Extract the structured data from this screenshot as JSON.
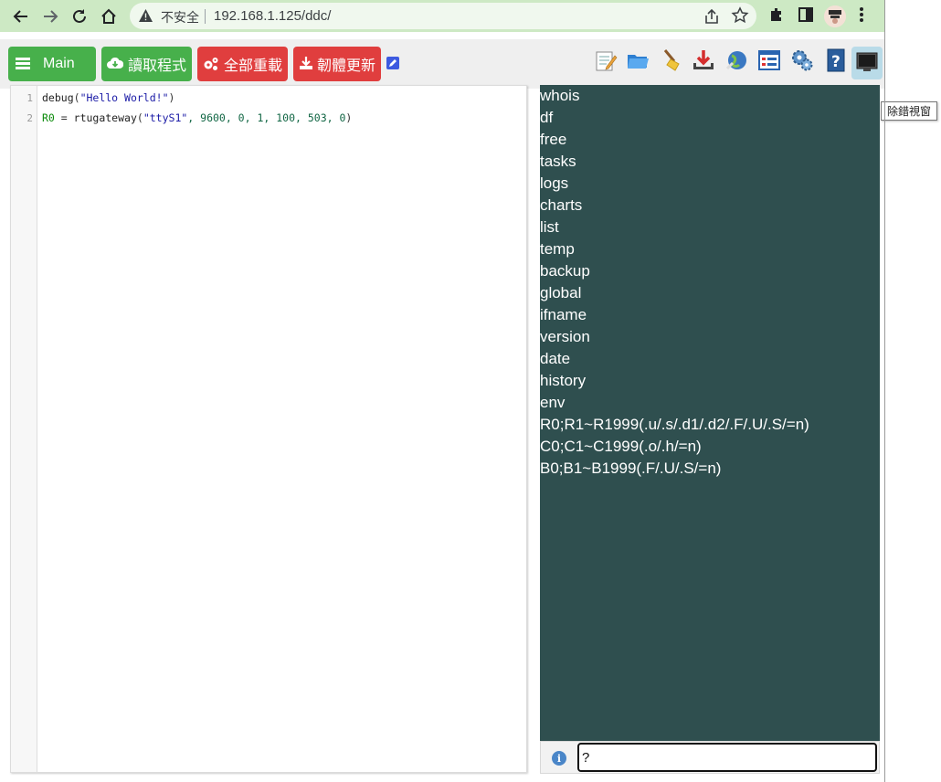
{
  "browser": {
    "insecure_label": "不安全",
    "url": "192.168.1.125/ddc/"
  },
  "toolbar": {
    "main_label": "Main",
    "read_label": "讀取程式",
    "reset_label": "全部重載",
    "firmware_label": "韌體更新",
    "tooltip": "除錯視窗"
  },
  "tools": [
    {
      "name": "edit-notes-icon"
    },
    {
      "name": "folder-open-icon"
    },
    {
      "name": "broom-icon"
    },
    {
      "name": "download-icon"
    },
    {
      "name": "network-globe-icon"
    },
    {
      "name": "list-window-icon"
    },
    {
      "name": "gears-icon"
    },
    {
      "name": "help-icon"
    },
    {
      "name": "monitor-icon"
    }
  ],
  "editor": {
    "line_numbers": [
      "1",
      "2"
    ],
    "lines": [
      {
        "fn": "debug",
        "open": "(",
        "str": "\"Hello World!\"",
        "close": ")"
      },
      {
        "var": "R0",
        "eq": " = ",
        "fn": "rtugateway",
        "open": "(",
        "str": "\"ttyS1\"",
        "rest": ", 9600, 0, 1, 100, 503, 0",
        "close": ")"
      }
    ]
  },
  "console": {
    "lines": [
      "whois",
      "df",
      "free",
      "tasks",
      "logs",
      "charts",
      "list",
      "temp",
      "backup",
      "global",
      "ifname",
      "version",
      "date",
      "history",
      "env",
      "R0;R1~R1999(.u/.s/.d1/.d2/.F/.U/.S/=n)",
      "C0;C1~C1999(.o/.h/=n)",
      "B0;B1~B1999(.F/.U/.S/=n)"
    ],
    "input_value": "?"
  },
  "colors": {
    "green": "#47b04b",
    "red": "#e03e3e",
    "console_bg": "#2f4f4f",
    "chrome_bg": "#cde9c4"
  }
}
